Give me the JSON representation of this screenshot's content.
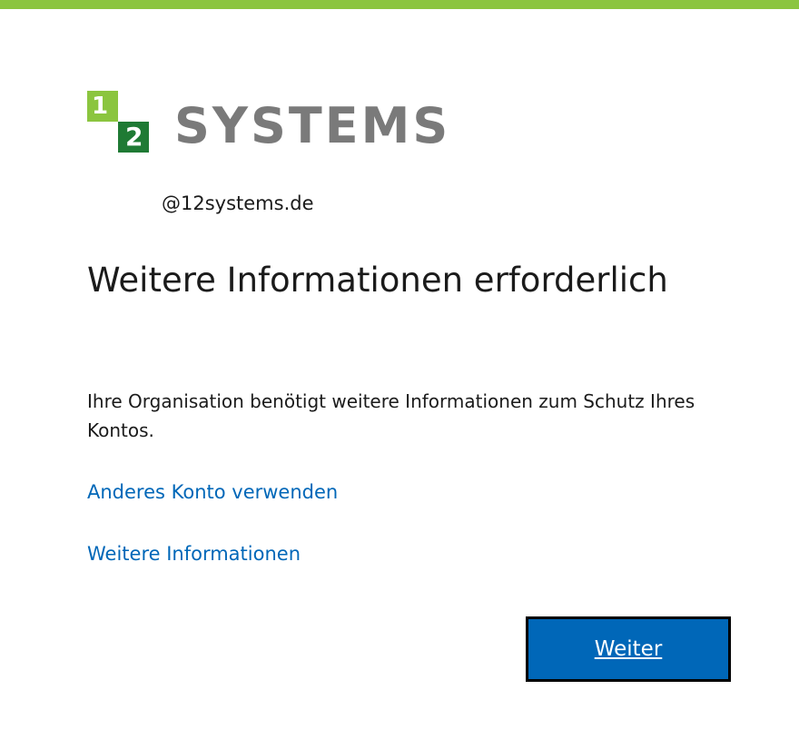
{
  "colors": {
    "top_bar": "#8bc53f",
    "logo_green_light": "#8bc53f",
    "logo_green_dark": "#1f7a34",
    "logo_text": "#7a7a7a",
    "link": "#0067b8",
    "button_bg": "#0067b8",
    "text": "#1b1b1b"
  },
  "logo": {
    "mark_1": "1",
    "mark_2": "2",
    "text": "SYSTEMS"
  },
  "account": {
    "email": "@12systems.de"
  },
  "main": {
    "title": "Weitere Informationen erforderlich",
    "description": "Ihre Organisation benötigt weitere Informationen zum Schutz Ihres Kontos.",
    "link_other_account": "Anderes Konto verwenden",
    "link_more_info": "Weitere Informationen",
    "next_button_label": "Weiter"
  }
}
